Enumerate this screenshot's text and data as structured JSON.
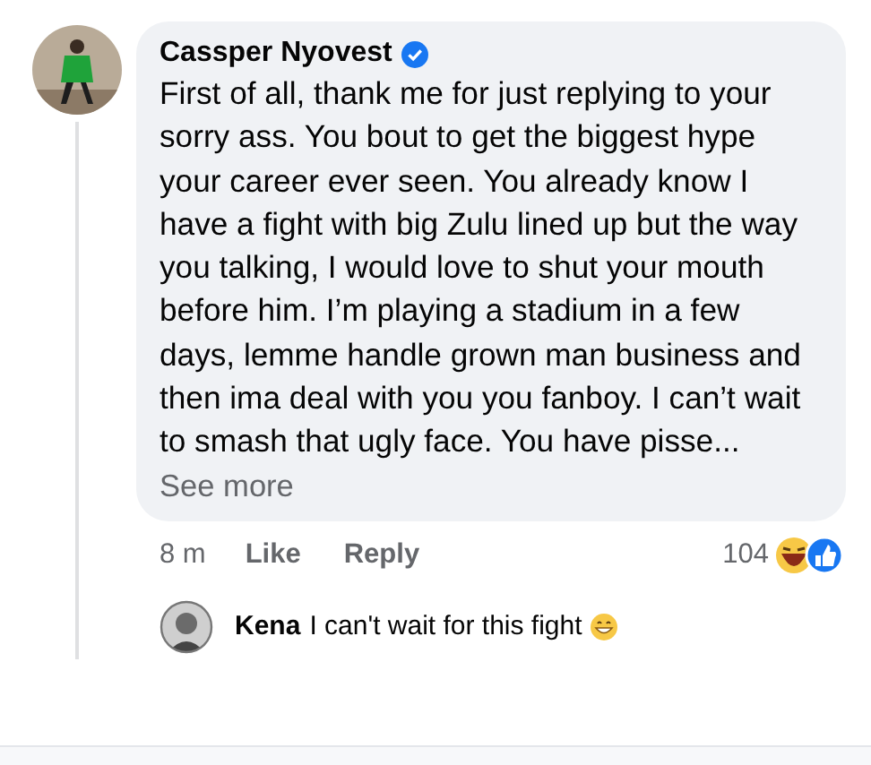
{
  "comment": {
    "author": "Cassper Nyovest",
    "verified": true,
    "text": "First of all, thank me for just replying to your sorry ass. You bout to get the biggest hype your career ever seen. You already know I have a fight with big Zulu lined up but the way you talking, I would love to shut your mouth before him. I’m playing a stadium in a few days, lemme handle grown man business and then ima deal with you you fanboy. I can’t wait to smash that ugly face. You have pisse...",
    "see_more": "See more",
    "time": "8 m",
    "actions": [
      "Like",
      "Reply"
    ],
    "reaction_count": "104"
  },
  "reply": {
    "author": "Kena",
    "text": "I can't wait for this fight"
  }
}
